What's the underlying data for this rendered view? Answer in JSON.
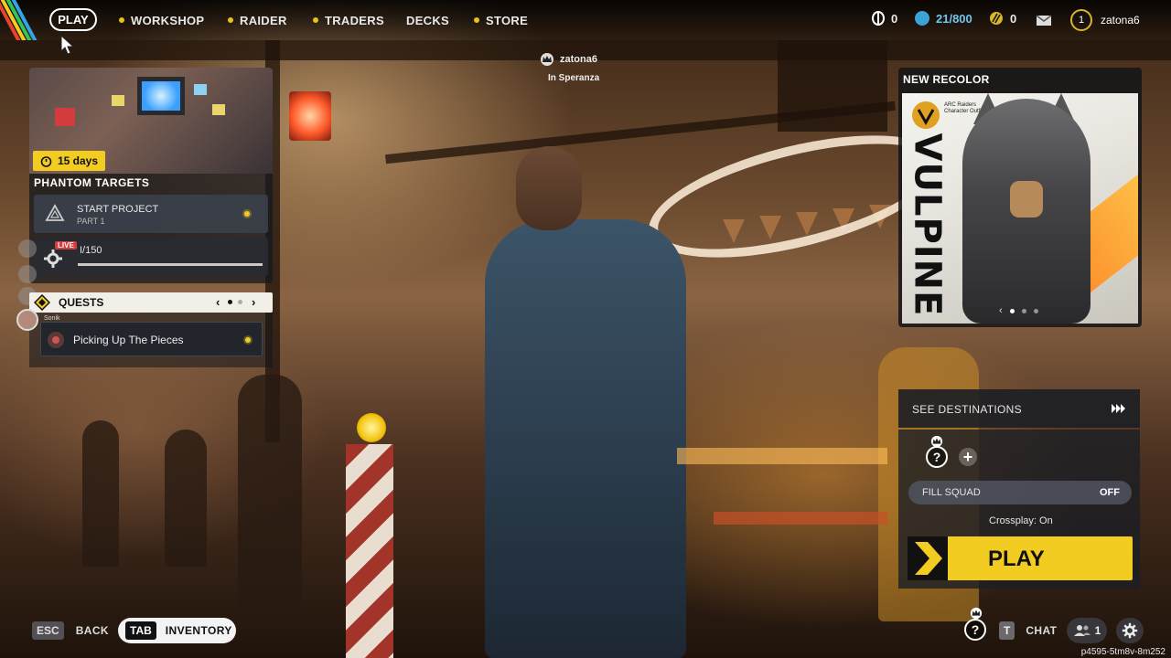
{
  "nav": {
    "play_label": "PLAY",
    "items": [
      "WORKSHOP",
      "RAIDER",
      "TRADERS",
      "DECKS",
      "STORE"
    ],
    "accent_color": "#e7c21d"
  },
  "currencies": {
    "coins": "0",
    "shared": "21/800",
    "tokens": "0"
  },
  "user": {
    "level": "1",
    "name": "zatona6",
    "location": "In Speranza"
  },
  "project": {
    "days_left": "15 days",
    "section_title": "PHANTOM TARGETS",
    "action_title": "START PROJECT",
    "action_sub": "PART 1",
    "progress_text": "I/150",
    "progress_fraction": 0.0,
    "live_badge": "LIVE"
  },
  "quests": {
    "title": "QUESTS",
    "active_quest": "Picking Up The Pieces",
    "friend_name": "Sonik",
    "page_index": 1,
    "page_count": 2
  },
  "promo": {
    "heading": "NEW RECOLOR",
    "product_line": "ARC Raiders",
    "product_type": "Character Outfit",
    "name": "VULPINE"
  },
  "lobby": {
    "destinations_label": "SEE DESTINATIONS",
    "fill_squad_label": "FILL SQUAD",
    "fill_squad_value": "OFF",
    "crossplay_text": "Crossplay: On",
    "play_label": "PLAY",
    "slot_placeholder": "?"
  },
  "bottom": {
    "esc_key": "ESC",
    "back_label": "BACK",
    "tab_key": "TAB",
    "inventory_label": "INVENTORY",
    "chat_key": "T",
    "chat_label": "CHAT",
    "friends_count": "1",
    "session_id": "p4595-5tm8v-8m252"
  }
}
